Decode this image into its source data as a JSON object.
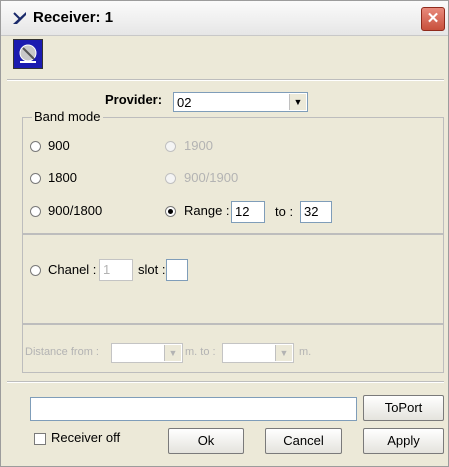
{
  "window": {
    "title": "Receiver: 1",
    "close_glyph": "✕"
  },
  "provider": {
    "label": "Provider:",
    "value": "02"
  },
  "band_mode": {
    "title": "Band mode",
    "options": {
      "b900": "900",
      "b1800": "1800",
      "b900_1800": "900/1800",
      "b1900": "1900",
      "b900_1900": "900/1900",
      "range": "Range :"
    },
    "range_from": "12",
    "to_label": "to :",
    "range_to": "32",
    "selected": "range"
  },
  "channel": {
    "label": "Chanel :",
    "value": "1",
    "slot_label": "slot :",
    "slot_value": ""
  },
  "distance": {
    "from_label": "Distance from :",
    "mid_label": "m. to :",
    "end_label": "m."
  },
  "footer": {
    "toport_value": "",
    "toport_label": "ToPort",
    "receiver_off_label": "Receiver off",
    "receiver_off_checked": false,
    "ok_label": "Ok",
    "cancel_label": "Cancel",
    "apply_label": "Apply"
  },
  "icons": {
    "app": "satellite-dish-icon",
    "toolbar": "satellite-icon"
  },
  "colors": {
    "close_button": "#c8503c",
    "toolbar_icon_bg": "#1b1bb0",
    "field_border": "#7f9db9",
    "dialog_bg": "#ece9d8"
  }
}
